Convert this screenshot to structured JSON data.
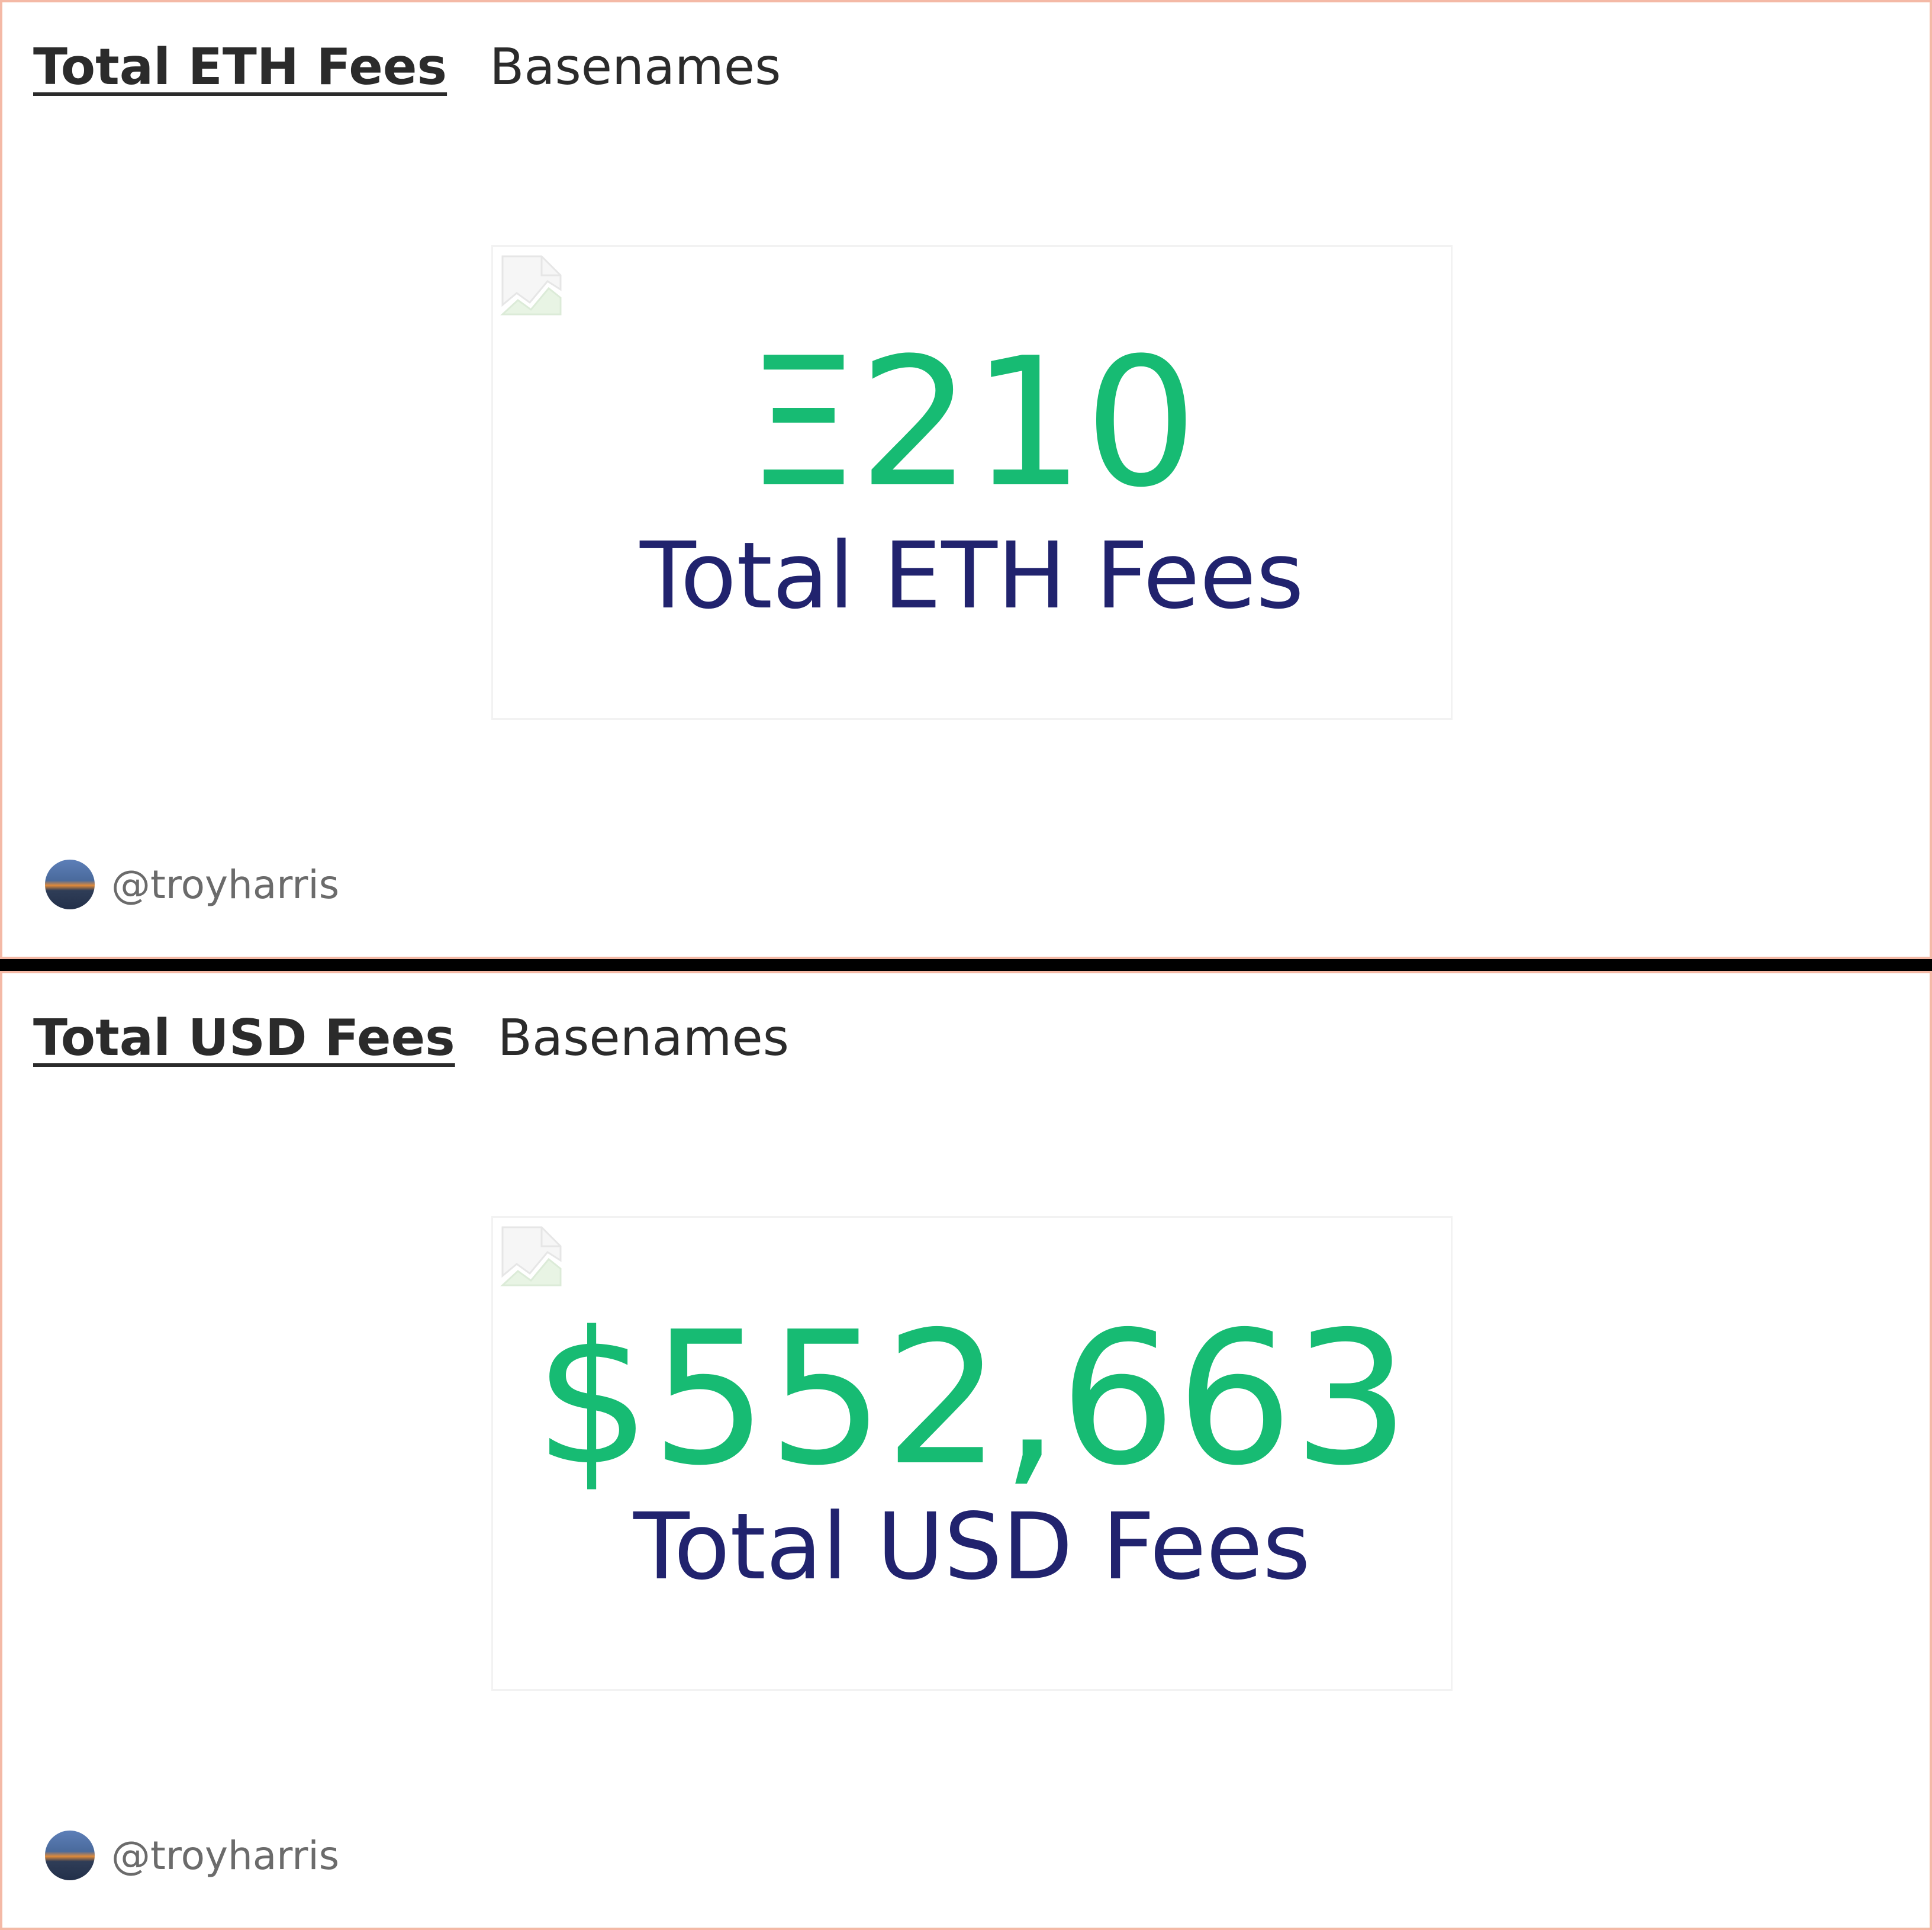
{
  "widgets": [
    {
      "title": "Total ETH Fees",
      "subtitle": "Basenames",
      "counter_value": "Ξ210",
      "counter_label": "Total ETH Fees",
      "author": "@troyharris"
    },
    {
      "title": "Total USD Fees",
      "subtitle": "Basenames",
      "counter_value": "$552,663",
      "counter_label": "Total USD Fees",
      "author": "@troyharris"
    }
  ],
  "icons": {
    "card_image": "broken-image-icon",
    "author_avatar": "avatar"
  },
  "colors": {
    "value": "#17bb73",
    "label": "#21236e",
    "widget_border": "#f4b9a6",
    "header_text": "#2b2b2b",
    "author_text": "#6b6b6b"
  }
}
